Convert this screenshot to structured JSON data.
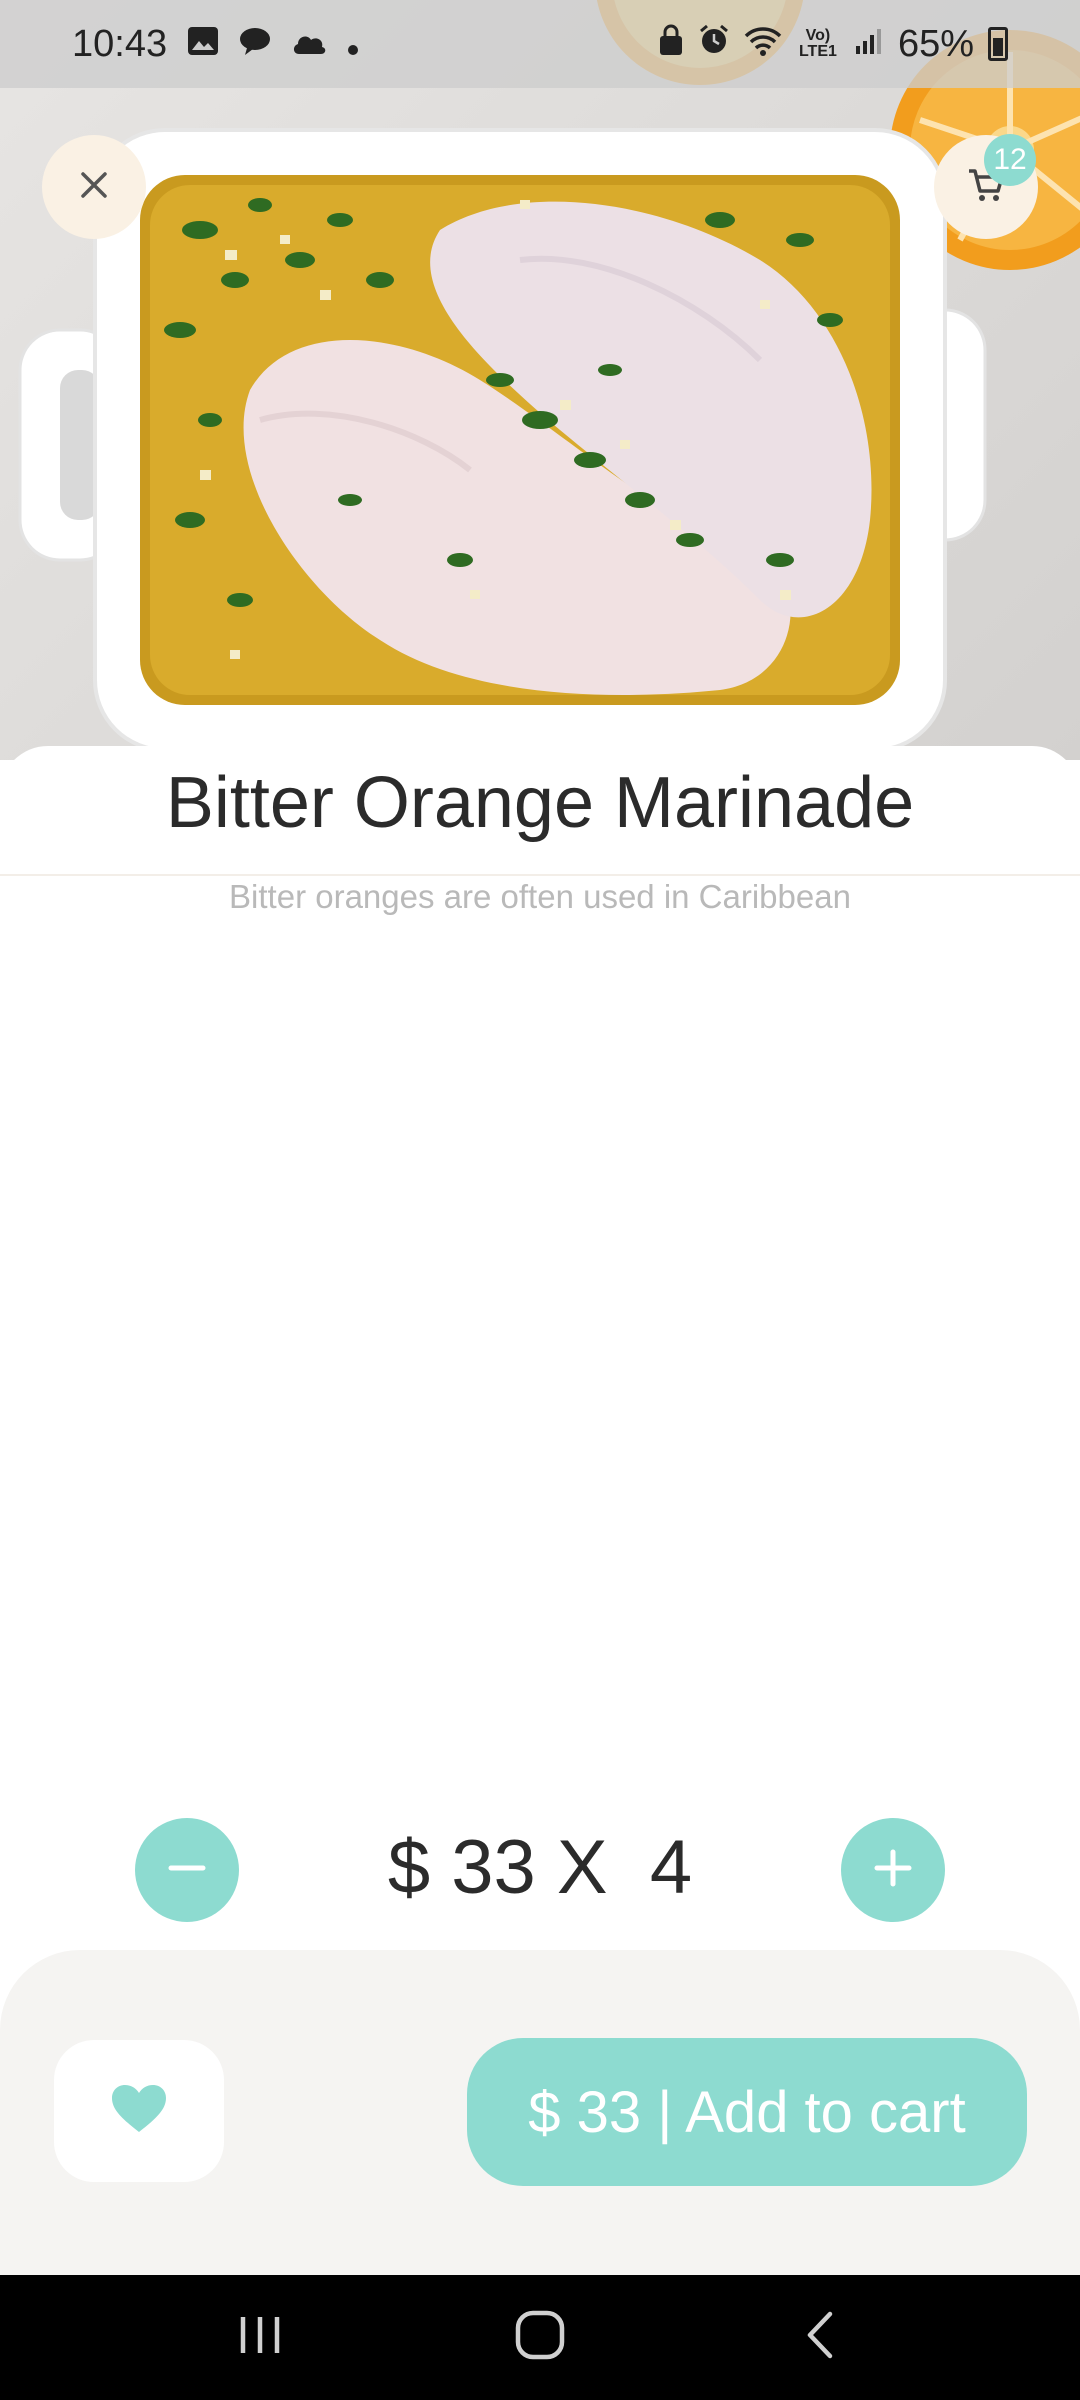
{
  "status_bar": {
    "time": "10:43",
    "battery": "65%",
    "network_label": "Vo) LTE1",
    "left_icons": [
      "image-icon",
      "message-icon",
      "cloud-icon",
      "dot-icon"
    ],
    "right_icons": [
      "lock-icon",
      "alarm-icon",
      "wifi-icon",
      "lte-icon",
      "signal-icon",
      "battery-icon"
    ]
  },
  "header": {
    "cart_count": "12"
  },
  "product": {
    "title": "Bitter Orange Marinade",
    "description": "Bitter oranges are often used in Caribbean",
    "image_subject": "chicken legs in bitter orange marinade"
  },
  "quantity": {
    "price_line": "$ 33 X  4",
    "unit_price": 33,
    "count": 4
  },
  "actions": {
    "add_to_cart_label": "$ 33 | Add to cart"
  },
  "colors": {
    "accent": "#8ddbd0",
    "cream": "#faf1e4",
    "panel": "#f5f4f2",
    "text": "#2b2b2b",
    "muted": "#b9b9b9"
  }
}
